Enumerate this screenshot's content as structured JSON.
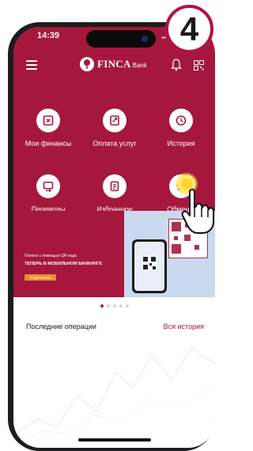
{
  "step_badge": "4",
  "status": {
    "time": "14:39"
  },
  "header": {
    "logo_name": "FINCA",
    "logo_sub": "Bank",
    "menu_icon": "menu-icon",
    "bell_icon": "bell-icon",
    "qr_icon": "qr-scan-icon"
  },
  "actions": [
    {
      "label": "Мои финансы",
      "icon": "finances-icon"
    },
    {
      "label": "Оплата услуг",
      "icon": "payment-icon"
    },
    {
      "label": "История",
      "icon": "history-icon"
    },
    {
      "label": "Переводы",
      "icon": "transfer-icon"
    },
    {
      "label": "Избранное",
      "icon": "favorites-icon"
    },
    {
      "label": "Обмен в",
      "icon": "exchange-icon"
    }
  ],
  "banner": {
    "line1": "Оплата с помощью QR-кода",
    "line2": "ТЕПЕРЬ В МОБИЛЬНОМ БАНКИНГЕ",
    "button": "ПОДРОБНЕЕ"
  },
  "carousel": {
    "count": 5,
    "active": 1
  },
  "operations": {
    "title": "Последние операции",
    "link": "Вся история"
  },
  "colors": {
    "brand": "#a6173d",
    "accent": "#f08a2c",
    "highlight": "#ffd52a"
  }
}
